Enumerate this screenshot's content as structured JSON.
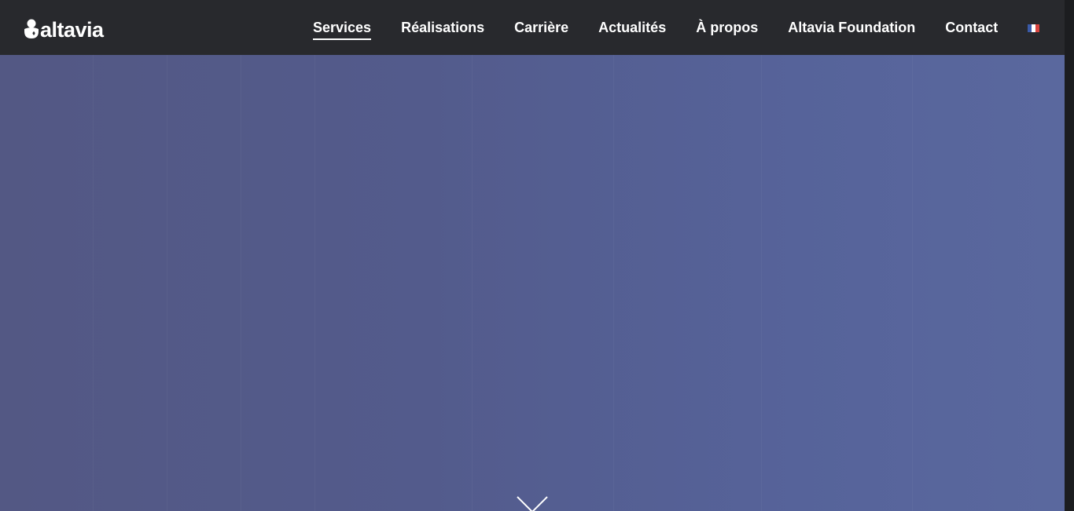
{
  "header": {
    "logo_text": "altavia",
    "logo_icon": "altavia-logo-mark",
    "nav": [
      {
        "label": "Services",
        "active": true
      },
      {
        "label": "Réalisations",
        "active": false
      },
      {
        "label": "Carrière",
        "active": false
      },
      {
        "label": "Actualités",
        "active": false
      },
      {
        "label": "À propos",
        "active": false
      },
      {
        "label": "Altavia Foundation",
        "active": false
      },
      {
        "label": "Contact",
        "active": false
      }
    ],
    "language_icon": "french-flag-icon"
  },
  "hero": {
    "scroll_icon": "chevron-down-icon"
  },
  "colors": {
    "header_bg": "#28292d",
    "hero_gradient_start": "#535884",
    "hero_gradient_end": "#5a689e",
    "text": "#ffffff"
  }
}
